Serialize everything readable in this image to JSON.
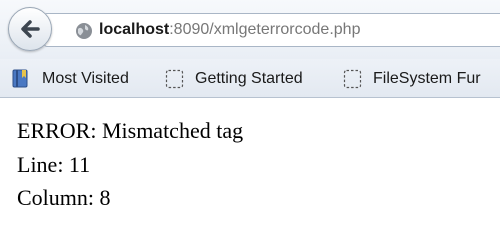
{
  "browser": {
    "back_icon": "back-arrow-icon",
    "url": {
      "host": "localhost",
      "rest": ":8090/xmlgeterrorcode.php"
    }
  },
  "bookmarks": [
    {
      "label": "Most Visited",
      "icon": "bookmarks-icon"
    },
    {
      "label": "Getting Started",
      "icon": "page-placeholder-icon"
    },
    {
      "label": "FileSystem Fur",
      "icon": "page-placeholder-icon"
    }
  ],
  "page": {
    "lines": [
      "ERROR: Mismatched tag",
      "Line: 11",
      "Column: 8"
    ]
  }
}
